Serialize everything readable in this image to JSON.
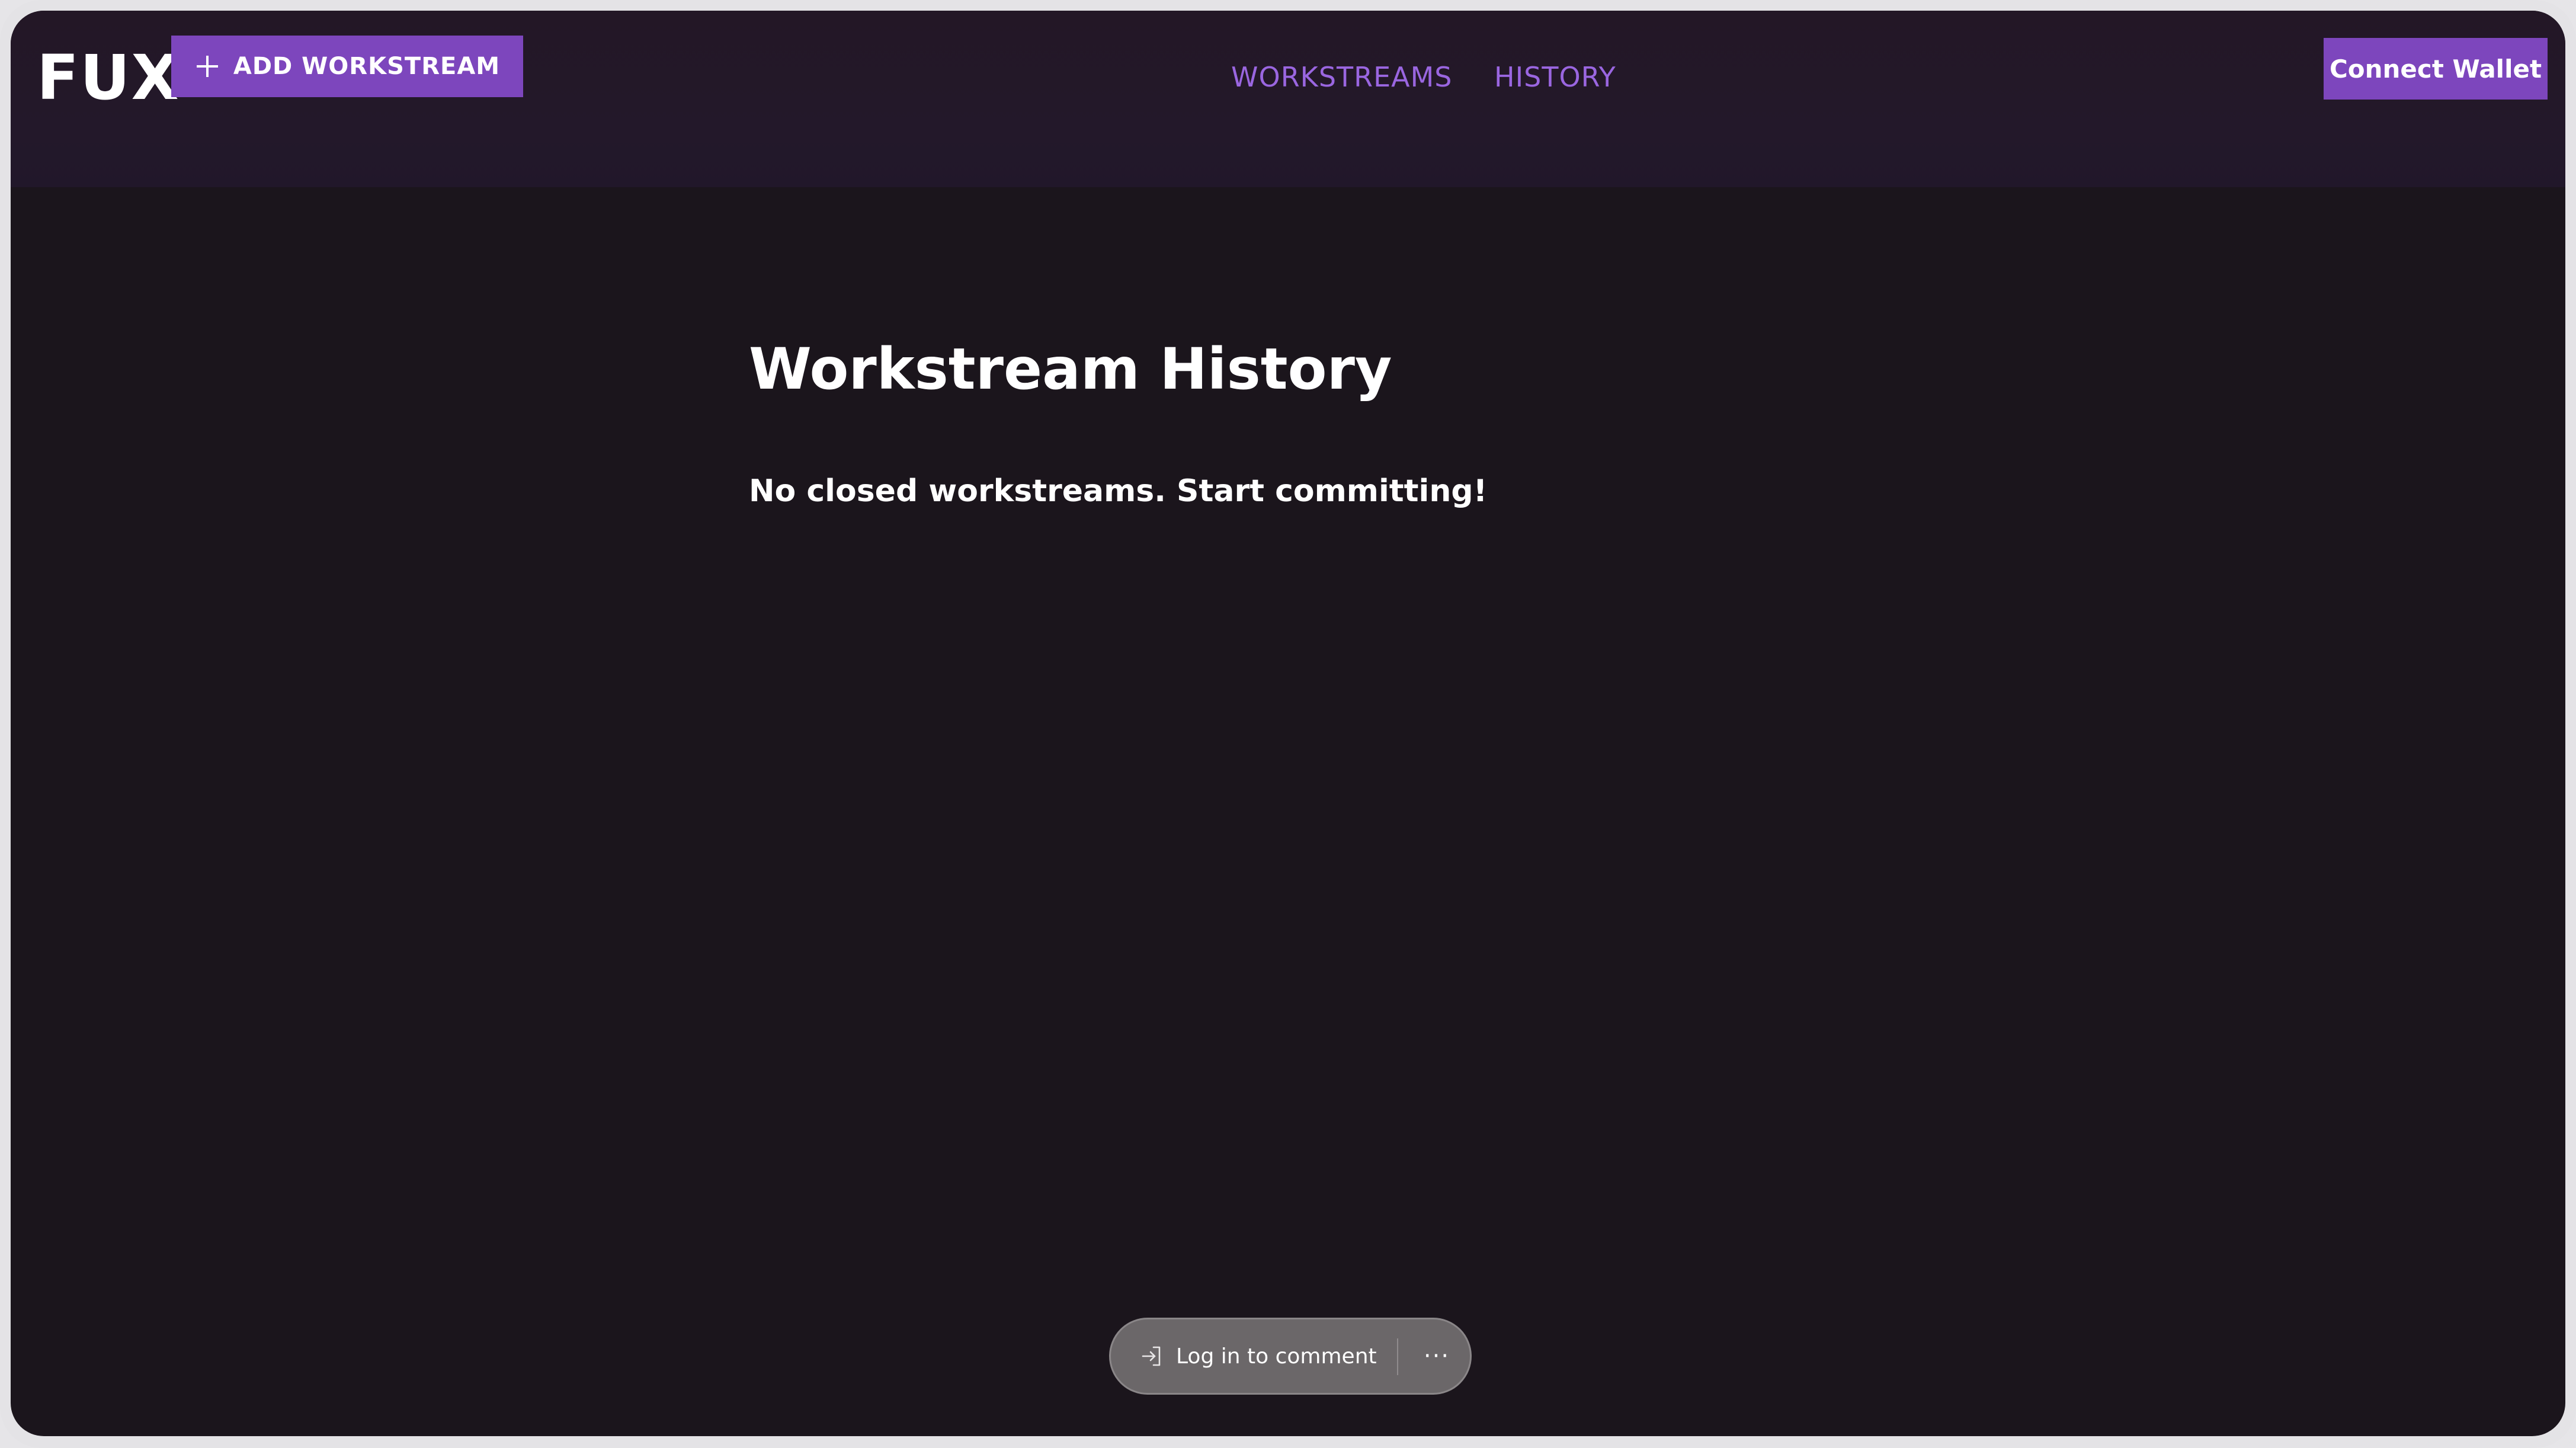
{
  "header": {
    "logo": "FUX",
    "add_button_label": "ADD WORKSTREAM",
    "add_button_icon": "plus-icon",
    "nav": [
      {
        "label": "WORKSTREAMS"
      },
      {
        "label": "HISTORY"
      }
    ],
    "connect_wallet_label": "Connect Wallet"
  },
  "main": {
    "title": "Workstream History",
    "empty_message": "No closed workstreams. Start committing!"
  },
  "comment_bar": {
    "login_label": "Log in to comment",
    "login_icon": "login-arrow-icon",
    "more_label": "···",
    "more_icon": "more-dots-icon"
  },
  "colors": {
    "accent": "#7d46bd",
    "nav_link": "#9a66e0",
    "background": "#1b151c",
    "header_background": "#231726"
  }
}
